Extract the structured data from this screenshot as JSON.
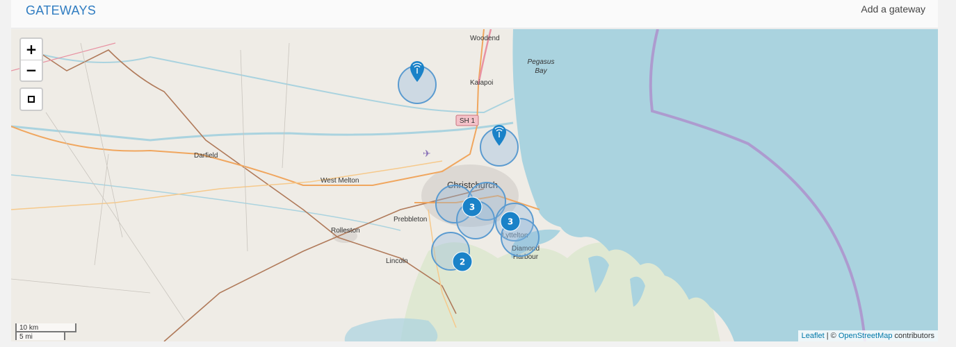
{
  "header": {
    "title": "GATEWAYS",
    "add_label": "Add a gateway"
  },
  "map": {
    "zoom_in_label": "+",
    "zoom_out_label": "−",
    "places": {
      "woodend": "Woodend",
      "pegasus_bay": [
        "Pegasus",
        "Bay"
      ],
      "kaiapoi": "Kaiapoi",
      "sh1": "SH 1",
      "darfield": "Darfield",
      "west_melton": "West Melton",
      "christchurch": "Christchurch",
      "prebbleton": "Prebbleton",
      "rolleston": "Rolleston",
      "lyttelton": "Lyttelton",
      "diamond_harbour": [
        "Diamond",
        "Harbour"
      ],
      "lincoln": "Lincoln"
    },
    "clusters": [
      {
        "count": "3"
      },
      {
        "count": "3"
      },
      {
        "count": "2"
      }
    ],
    "gateway_icon": "antenna-marker-icon",
    "scale": {
      "metric": "10 km",
      "imperial": "5 mi"
    },
    "attribution": {
      "leaflet": "Leaflet",
      "separator": " | © ",
      "osm": "OpenStreetMap",
      "suffix": " contributors"
    },
    "colors": {
      "sea": "#aad3df",
      "land": "#efece6",
      "coverage_fill": "#8fb8dc",
      "coverage_stroke": "#5b9bd0",
      "marker": "#1a82c8",
      "boundary": "#ad9bcf"
    }
  }
}
